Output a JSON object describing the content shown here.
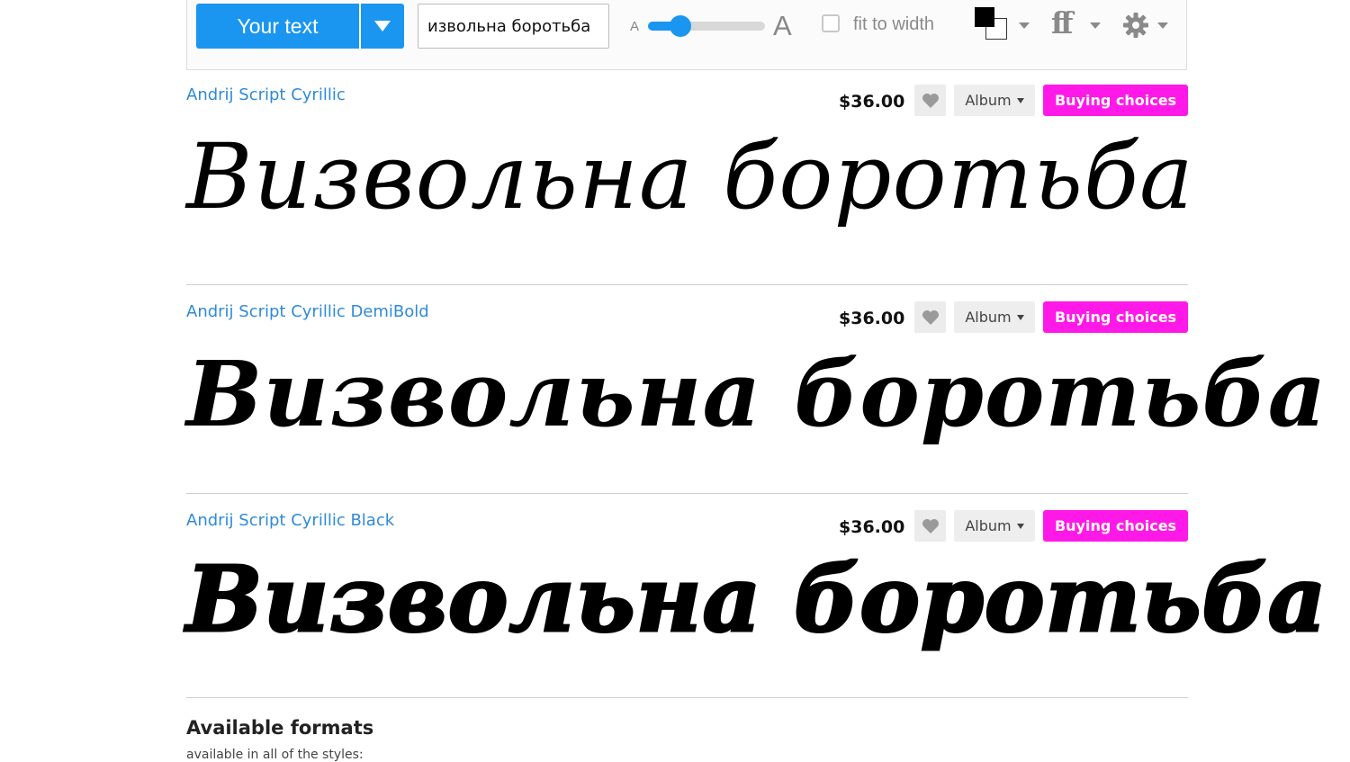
{
  "toolbar": {
    "your_text_label": "Your text",
    "input_value": "извольна боротьба",
    "size_small_label": "A",
    "size_large_label": "A",
    "size_slider_value": 0.28,
    "fit_to_width_label": "fit to width",
    "fit_to_width_checked": false,
    "text_color": "#000000",
    "background_color": "#ffffff",
    "ff_label": "ff",
    "accent_color": "#1a96f0"
  },
  "sample_text": "Визвольна боротьба",
  "fonts": [
    {
      "name": "Andrij Script Cyrillic",
      "price": "$36.00",
      "album_label": "Album",
      "buy_label": "Buying choices",
      "weight": "normal"
    },
    {
      "name": "Andrij Script Cyrillic DemiBold",
      "price": "$36.00",
      "album_label": "Album",
      "buy_label": "Buying choices",
      "weight": "demibold"
    },
    {
      "name": "Andrij Script Cyrillic Black",
      "price": "$36.00",
      "album_label": "Album",
      "buy_label": "Buying choices",
      "weight": "black"
    }
  ],
  "formats": {
    "title": "Available formats",
    "subtitle": "available in all of the styles:"
  },
  "colors": {
    "link": "#2f8ad8",
    "buy_button": "#ff19e8",
    "primary_button": "#1a96f0"
  }
}
